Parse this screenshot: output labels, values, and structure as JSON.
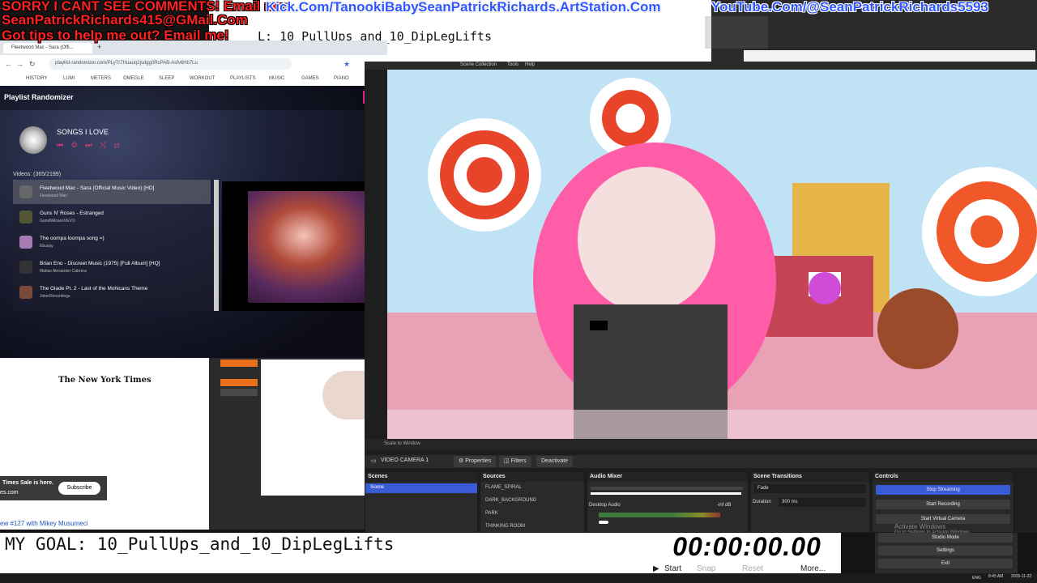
{
  "overlay": {
    "line1": "SORRY I CANT SEE COMMENTS! Email me:",
    "line2": "SeanPatrickRichards415@GMail.Com",
    "line3": "Got tips to help me out? Email me!",
    "link1": "Kick.Com/TanookiBaby2",
    "link2": "SeanPatrickRichards.ArtStation.Com",
    "link3": "YouTube.Com/@SeanPatrickRichards5593"
  },
  "note_window": {
    "goal_text": "L: 10_PullUps_and_10_DipLegLifts"
  },
  "browser": {
    "tab_title": "Fleetwood Mac - Sara (Offi...",
    "url": "playlist-randomizer.com/PLyTr7Huauq2jsdgg0RcPAB-Asfv6Hb7Lu",
    "bookmarks": [
      "HISTORY",
      "LUMI",
      "METERS",
      "OMEGLE",
      "SLEEP",
      "WORKOUT",
      "PLAYLISTS",
      "MUSIC",
      "GAMES",
      "PIANO"
    ],
    "app_title": "Playlist Randomizer",
    "buy_label": "Bu",
    "playlist_name": "SONGS I LOVE",
    "controls": [
      "⏮",
      "◎",
      "⏭",
      "⤭",
      "⇄"
    ],
    "videos_count": "Videos: (365/2199)",
    "videos": [
      {
        "title": "Fleetwood Mac - Sara (Official Music Video) [HD]",
        "channel": "Fleetwood Mac"
      },
      {
        "title": "Guns N' Roses - Estranged",
        "channel": "GunsNRosesVEVO"
      },
      {
        "title": "The oompa loompa song =)",
        "channel": "Ebusay"
      },
      {
        "title": "Brian Eno - Discreet Music (1975) [Full Album] [HQ]",
        "channel": "Matias Alexander Cabrera"
      },
      {
        "title": "The Glade Pt. 2 - Last of the Mohicans Theme",
        "channel": "JokerRecordings"
      }
    ]
  },
  "nyt": {
    "logo": "The New York Times",
    "sale_text": "Times Sale is here.",
    "sale_sub": "es.com",
    "subscribe": "Subscribe",
    "footer": "ew #127 with Mikey Musumeci"
  },
  "mid_text": "MY",
  "obs": {
    "menu_items": [
      "Scene Collection",
      "Tools",
      "Help"
    ],
    "bar1_items": [
      "Scale to Window"
    ],
    "source_name": "VIDEO CAMERA 1",
    "properties": "Properties",
    "filters": "Filters",
    "deactivate": "Deactivate",
    "scenes_header": "Scenes",
    "scenes": [
      "Scene"
    ],
    "sources_header": "Sources",
    "sources": [
      "FLAME_SPIRAL",
      "DARK_BACKGROUND",
      "PARK",
      "THINKING ROOM"
    ],
    "mixer_header": "Audio Mixer",
    "mixer_track": "Desktop Audio",
    "mixer_db": "-inf dB",
    "transitions_header": "Scene Transitions",
    "transition": "Fade",
    "duration_label": "Duration",
    "duration": "300 ms",
    "controls_header": "Controls",
    "controls": [
      "Stop Streaming",
      "Start Recording",
      "Start Virtual Camera",
      "Studio Mode",
      "Settings",
      "Exit"
    ]
  },
  "windows_watermark": {
    "line1": "Activate Windows",
    "line2": "Go to Settings to activate Windows."
  },
  "bottom": {
    "goal": "MY GOAL: 10_PullUps_and_10_DipLegLifts",
    "timer": "00:00:00.00",
    "timer_buttons": [
      "Start",
      "Snap",
      "Reset",
      "More..."
    ]
  },
  "taskbar": {
    "time": "8:45 AM",
    "date": "2025-11-22",
    "lang": "ENG"
  },
  "colors": {
    "overlay_red": "#ff2020",
    "overlay_blue": "#2f56ff",
    "obs_accent": "#3a5bd6"
  }
}
